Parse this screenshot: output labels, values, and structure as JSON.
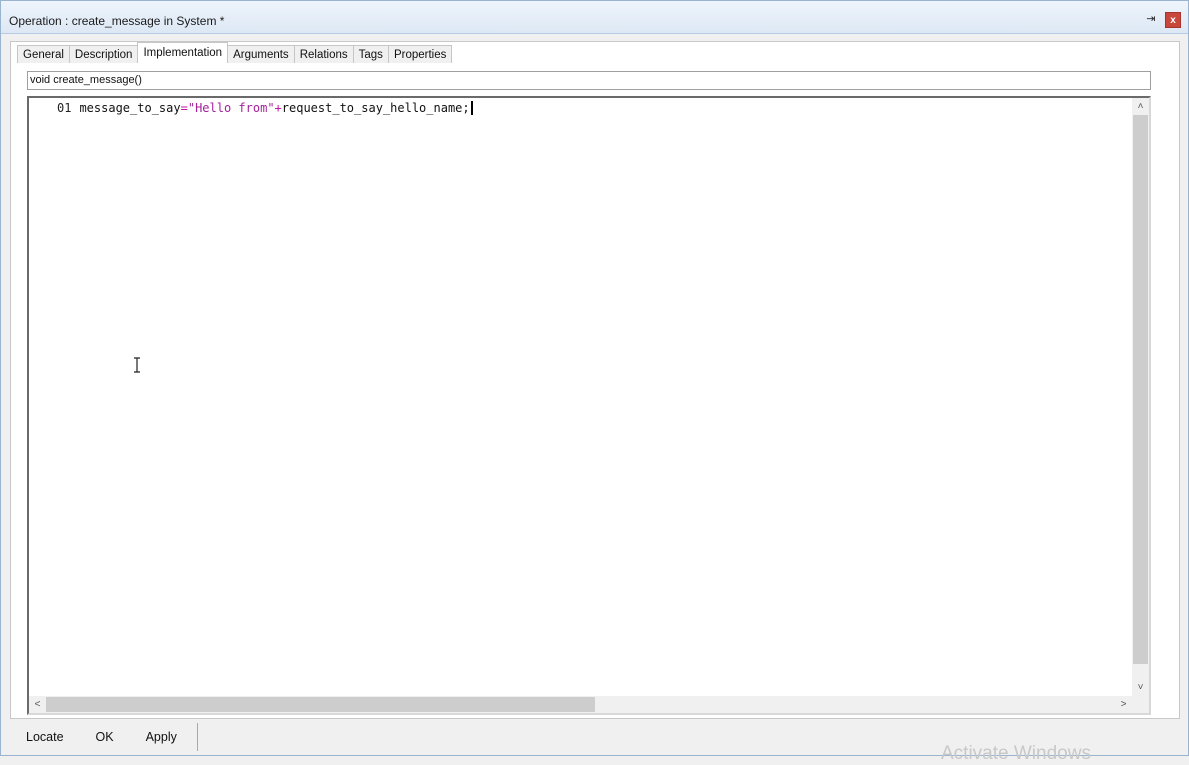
{
  "window": {
    "title": "Operation : create_message in System *",
    "pin_glyph": "⇥",
    "close_glyph": "x"
  },
  "tabs": [
    {
      "label": "General"
    },
    {
      "label": "Description"
    },
    {
      "label": "Implementation",
      "active": true
    },
    {
      "label": "Arguments"
    },
    {
      "label": "Relations"
    },
    {
      "label": "Tags"
    },
    {
      "label": "Properties"
    }
  ],
  "signature": {
    "value": "void create_message()"
  },
  "editor": {
    "line_number": "01",
    "code": {
      "identifier": "message_to_say",
      "assign": "=",
      "string": "\"Hello from\"",
      "plus": "+",
      "rest": "request_to_say_hello_name;"
    },
    "scroll_up": "˄",
    "scroll_down": "˅",
    "scroll_left": "<",
    "scroll_right": ">"
  },
  "buttons": {
    "locate": "Locate",
    "ok": "OK",
    "apply": "Apply"
  },
  "watermark": "Activate Windows",
  "colors": {
    "string": "#a3229a",
    "operator": "#c0179d",
    "close": "#c9463d"
  }
}
